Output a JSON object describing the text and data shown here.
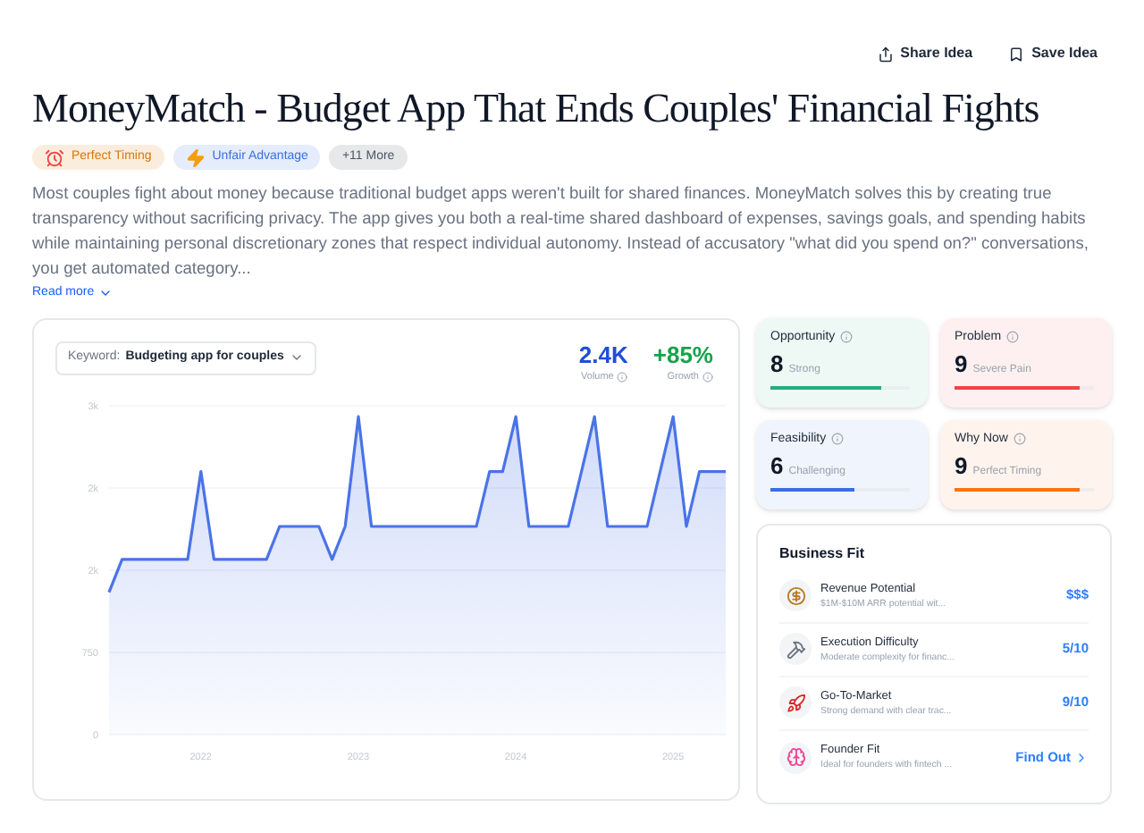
{
  "header_actions": [
    "Share Idea",
    "Save Idea"
  ],
  "title": "MoneyMatch - Budget App That Ends Couples' Financial Fights",
  "tags": [
    {
      "kind": "timing",
      "label": "Perfect Timing",
      "color": "#d97706"
    },
    {
      "kind": "advantage",
      "label": "Unfair Advantage",
      "color": "#3b6fe0"
    },
    {
      "kind": "more",
      "label": "+11 More",
      "color": "#4b5563"
    }
  ],
  "description": "Most couples fight about money because traditional budget apps weren't built for shared finances. MoneyMatch solves this by creating true transparency without sacrificing privacy. The app gives you both a real-time shared dashboard of expenses, savings goals, and spending habits while maintaining personal discretionary zones that respect individual autonomy. Instead of accusatory \"what did you spend on?\" conversations, you get automated category...",
  "read_more": "Read more",
  "trend": {
    "keyword_label": "Keyword:",
    "keyword": "Budgeting app for couples",
    "stats": [
      {
        "value": "2.4K",
        "label": "Volume",
        "color": "#1d4ed8"
      },
      {
        "value": "+85%",
        "label": "Growth",
        "color": "#16a34a"
      }
    ],
    "chart_data": {
      "type": "area",
      "categories": [
        null,
        null,
        null,
        null,
        null,
        null,
        null,
        "2022",
        null,
        null,
        null,
        null,
        null,
        null,
        null,
        null,
        null,
        null,
        null,
        "2023",
        null,
        null,
        null,
        null,
        null,
        null,
        null,
        null,
        null,
        null,
        null,
        "2024",
        null,
        null,
        null,
        null,
        null,
        null,
        null,
        null,
        null,
        null,
        null,
        "2025",
        null,
        null,
        null,
        null
      ],
      "series": [
        {
          "color": "#4a73e8",
          "values": [
            1300,
            1600,
            1600,
            1600,
            1600,
            1600,
            1600,
            2400,
            1600,
            1600,
            1600,
            1600,
            1600,
            1900,
            1900,
            1900,
            1900,
            1600,
            1900,
            2900,
            1900,
            1900,
            1900,
            1900,
            1900,
            1900,
            1900,
            1900,
            1900,
            2400,
            2400,
            2900,
            1900,
            1900,
            1900,
            1900,
            2400,
            2900,
            1900,
            1900,
            1900,
            1900,
            2400,
            2900,
            1900,
            2400,
            2400,
            2400
          ]
        }
      ],
      "ylim": [
        0,
        3000
      ],
      "grid": true,
      "yticks": [
        {
          "value": 0,
          "label": "0"
        },
        {
          "value": 750,
          "label": "750"
        },
        {
          "value": 1500,
          "label": "2k"
        },
        {
          "value": 2250,
          "label": "2k"
        },
        {
          "value": 3000,
          "label": "3k"
        }
      ]
    }
  },
  "scores": [
    {
      "label": "Opportunity",
      "score": "8",
      "verdict": "Strong",
      "level": 0.8,
      "color": "#22b07d"
    },
    {
      "label": "Problem",
      "score": "9",
      "verdict": "Severe Pain",
      "level": 0.9,
      "color": "#ef4444"
    },
    {
      "label": "Feasibility",
      "score": "6",
      "verdict": "Challenging",
      "level": 0.6,
      "color": "#3b6fe0"
    },
    {
      "label": "Why Now",
      "score": "9",
      "verdict": "Perfect Timing",
      "level": 0.9,
      "color": "#f97316"
    }
  ],
  "business_fit": {
    "title": "Business Fit",
    "rows": [
      {
        "kind": "revenue",
        "name": "Revenue Potential",
        "detail": "$1M-$10M ARR potential wit...",
        "value": "$$$"
      },
      {
        "kind": "execution",
        "name": "Execution Difficulty",
        "detail": "Moderate complexity for financ...",
        "value": "5/10"
      },
      {
        "kind": "market",
        "name": "Go-To-Market",
        "detail": "Strong demand with clear trac...",
        "value": "9/10"
      },
      {
        "kind": "founder",
        "name": "Founder Fit",
        "detail": "Ideal for founders with fintech ...",
        "value": "Find Out",
        "link": true
      }
    ]
  }
}
